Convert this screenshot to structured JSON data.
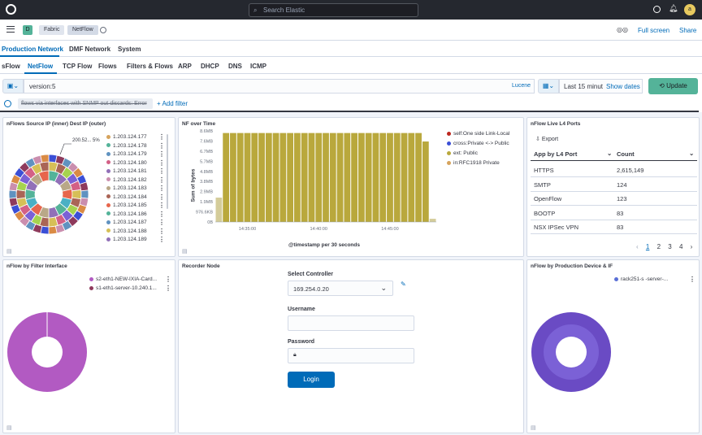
{
  "topbar": {
    "search_placeholder": "Search Elastic",
    "avatar_letter": "a"
  },
  "header": {
    "space_letter": "D",
    "breadcrumbs": [
      "Fabric",
      "NetFlow"
    ],
    "full_screen": "Full screen",
    "share": "Share"
  },
  "nav_tabs": [
    "Production Network",
    "DMF Network",
    "System"
  ],
  "sub_tabs": [
    "sFlow",
    "NetFlow",
    "TCP Flow",
    "Flows",
    "Filters & Flows",
    "ARP",
    "DHCP",
    "DNS",
    "ICMP"
  ],
  "query": {
    "value": "version:5",
    "lang": "Lucene",
    "time_range": "Last 15 minut",
    "show_dates": "Show dates",
    "update": "Update"
  },
  "filters": {
    "filter_pill": "flows via interfaces with SNMP out discards: Error",
    "add_filter": "+ Add filter"
  },
  "panels": {
    "src_ip": {
      "title": "nFlows Source IP (inner) Dest IP (outer)",
      "tooltip": "200.52... 5%",
      "legend": [
        "1.203.124.177",
        "1.203.124.178",
        "1.203.124.179",
        "1.203.124.180",
        "1.203.124.181",
        "1.203.124.182",
        "1.203.124.183",
        "1.203.124.184",
        "1.203.124.185",
        "1.203.124.186",
        "1.203.124.187",
        "1.203.124.188",
        "1.203.124.189"
      ]
    },
    "nf_time": {
      "title": "NF over Time",
      "ylabel": "Sum of bytes",
      "xlabel": "@timestamp per 30 seconds",
      "legend": [
        "self:One side Link-Local",
        "cross:Private <-> Public",
        "ext: Public",
        "in:RFC1918 Private"
      ]
    },
    "l4": {
      "title": "nFlow Live L4 Ports",
      "export": "Export",
      "col1": "App by L4 Port",
      "col2": "Count",
      "rows": [
        [
          "HTTPS",
          "2,615,149"
        ],
        [
          "SMTP",
          "124"
        ],
        [
          "OpenFlow",
          "123"
        ],
        [
          "BOOTP",
          "83"
        ],
        [
          "NSX IPSec VPN",
          "83"
        ]
      ],
      "pages": [
        "1",
        "2",
        "3",
        "4"
      ]
    },
    "filter_if": {
      "title": "nFlow by Filter Interface",
      "legend": [
        "s2-eth1-NEW-IXIA-Card...",
        "s1-eth1-server-10.240.1..."
      ]
    },
    "recorder": {
      "title": "Recorder Node",
      "select_label": "Select Controller",
      "select_value": "169.254.0.20",
      "username_label": "Username",
      "password_label": "Password",
      "login": "Login"
    },
    "prod_dev": {
      "title": "nFlow by Production Device & IF",
      "legend": [
        "rack251-s         -server-..."
      ]
    }
  },
  "chart_data": {
    "type": "bar",
    "title": "NF over Time",
    "ylabel": "Sum of bytes",
    "xlabel": "@timestamp per 30 seconds",
    "x_ticks": [
      "14:35:00",
      "14:40:00",
      "14:45:00"
    ],
    "y_ticks": [
      "0B",
      "976.6KB",
      "1.9MB",
      "2.9MB",
      "3.8MB",
      "4.8MB",
      "5.7MB",
      "6.7MB",
      "7.6MB",
      "8.6MB"
    ],
    "ylim_mb": [
      0,
      8.6
    ],
    "series": [
      {
        "name": "ext: Public",
        "color": "#b9a83c",
        "values": [
          2.3,
          8.4,
          8.4,
          8.4,
          8.4,
          8.4,
          8.4,
          8.4,
          8.4,
          8.4,
          8.4,
          8.4,
          8.4,
          8.4,
          8.4,
          8.4,
          8.4,
          8.4,
          8.4,
          8.4,
          8.4,
          8.4,
          8.4,
          8.4,
          8.4,
          8.4,
          8.4,
          8.4,
          8.4,
          7.6,
          0.3
        ]
      }
    ],
    "legend_colors": [
      "#bd271e",
      "#3b4fd6",
      "#b9a83c",
      "#d6a35c"
    ]
  },
  "colors": {
    "accent": "#006bb8",
    "update": "#54b399",
    "topbar": "#25282f",
    "pie_purple": "#b25ac2",
    "donut_outer": "#6a4bc4",
    "donut_inner": "#7b61d6"
  }
}
